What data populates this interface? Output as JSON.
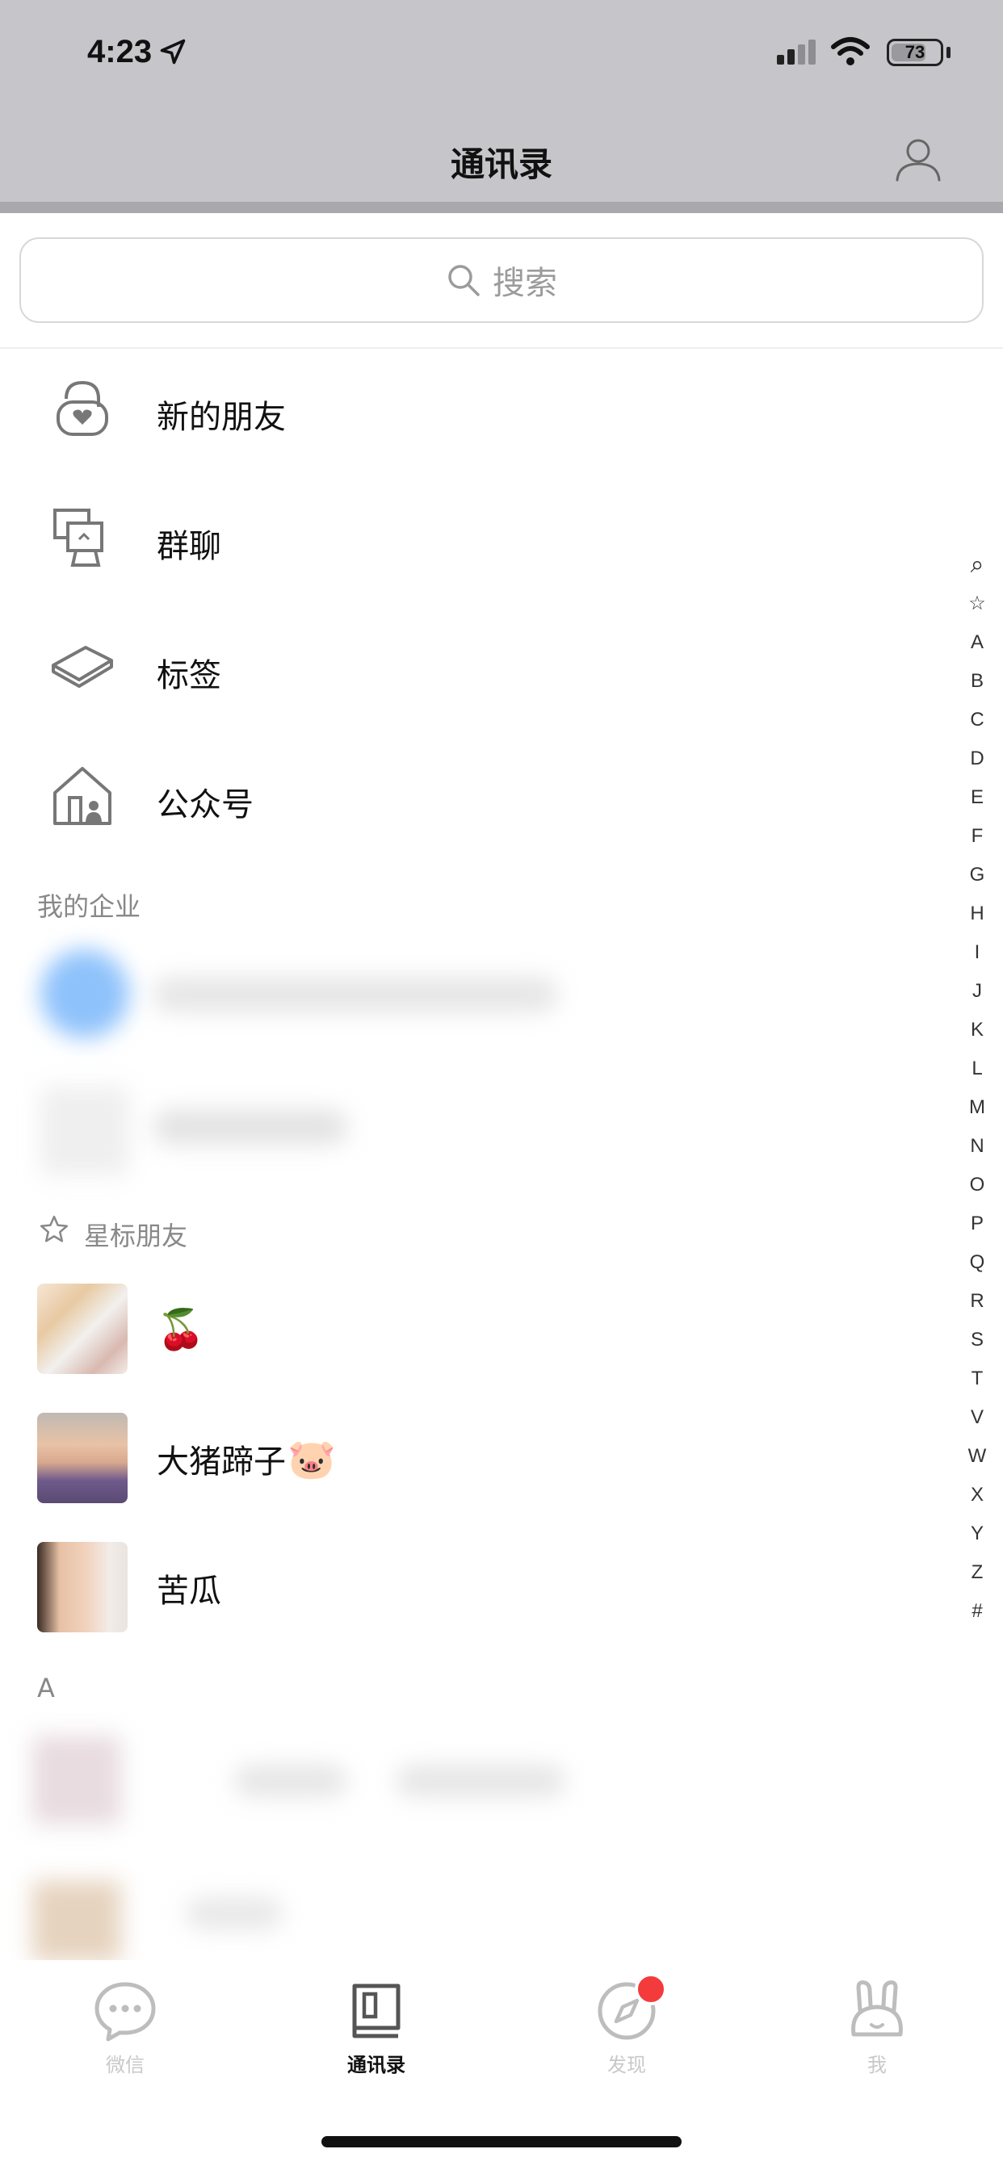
{
  "status_bar": {
    "time": "4:23",
    "battery": "73",
    "battery_level": 0.73
  },
  "header": {
    "title": "通讯录"
  },
  "search": {
    "placeholder": "搜索"
  },
  "functions": [
    {
      "label": "新的朋友",
      "icon": "new-friend-icon"
    },
    {
      "label": "群聊",
      "icon": "group-chat-icon"
    },
    {
      "label": "标签",
      "icon": "tag-icon"
    },
    {
      "label": "公众号",
      "icon": "official-account-icon"
    }
  ],
  "sections": {
    "enterprise": "我的企业",
    "starred": "星标朋友",
    "a": "A"
  },
  "starred_contacts": [
    {
      "name": "",
      "emoji": "🍒"
    },
    {
      "name": "大猪蹄子",
      "emoji": "🐷"
    },
    {
      "name": "苦瓜",
      "emoji": ""
    }
  ],
  "index": [
    "Q",
    "☆",
    "A",
    "B",
    "C",
    "D",
    "E",
    "F",
    "G",
    "H",
    "I",
    "J",
    "K",
    "L",
    "M",
    "N",
    "O",
    "P",
    "Q",
    "R",
    "S",
    "T",
    "V",
    "W",
    "X",
    "Y",
    "Z",
    "#"
  ],
  "tabs": [
    {
      "label": "微信",
      "icon": "chat-bubble-icon",
      "active": false
    },
    {
      "label": "通讯录",
      "icon": "contacts-book-icon",
      "active": true
    },
    {
      "label": "发现",
      "icon": "compass-icon",
      "active": false,
      "badge": true
    },
    {
      "label": "我",
      "icon": "bunny-icon",
      "active": false
    }
  ],
  "colors": {
    "header_bg": "#c6c5c9",
    "badge": "#f43b3b",
    "inactive_tab": "#c8c8c8"
  }
}
